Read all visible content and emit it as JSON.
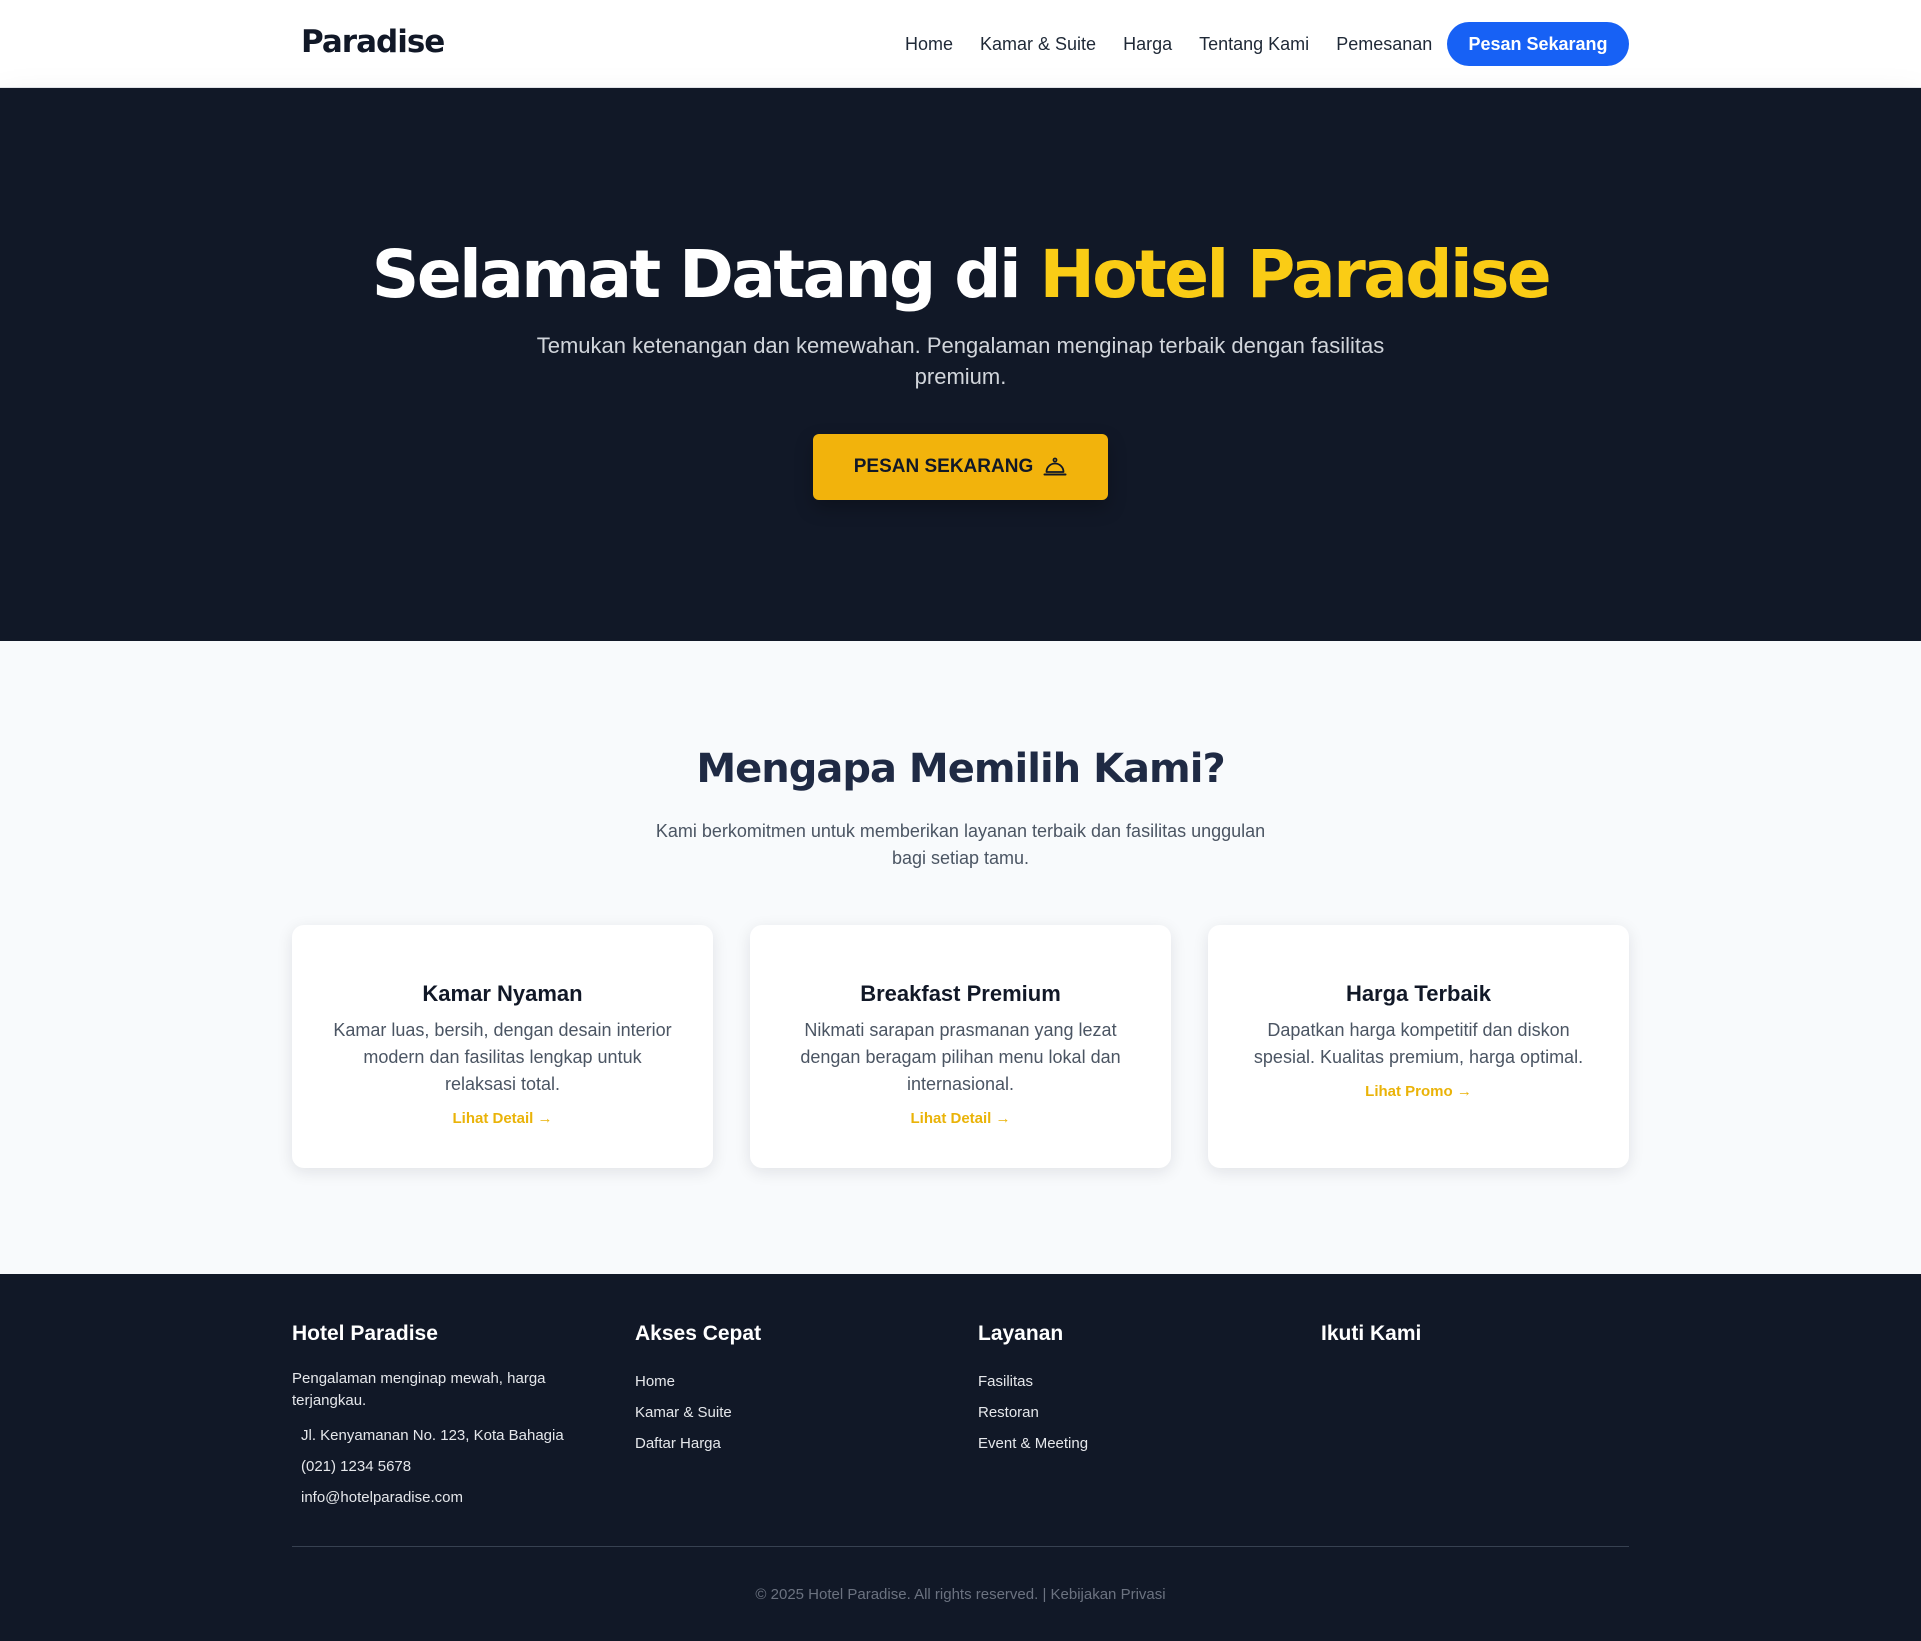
{
  "navbar": {
    "brand": "Paradise",
    "links": [
      "Home",
      "Kamar & Suite",
      "Harga",
      "Tentang Kami",
      "Pemesanan"
    ],
    "cta": "Pesan Sekarang"
  },
  "hero": {
    "title_main": "Selamat Datang di ",
    "title_accent": "Hotel Paradise",
    "subtitle": "Temukan ketenangan dan kemewahan. Pengalaman menginap terbaik dengan fasilitas premium.",
    "button": "PESAN SEKARANG",
    "button_icon": "bell-icon"
  },
  "features": {
    "title": "Mengapa Memilih Kami?",
    "subtitle": "Kami berkomitmen untuk memberikan layanan terbaik dan fasilitas unggulan bagi setiap tamu.",
    "cards": [
      {
        "title": "Kamar Nyaman",
        "text": "Kamar luas, bersih, dengan desain interior modern dan fasilitas lengkap untuk relaksasi total.",
        "link": "Lihat Detail →"
      },
      {
        "title": "Breakfast Premium",
        "text": "Nikmati sarapan prasmanan yang lezat dengan beragam pilihan menu lokal dan internasional.",
        "link": "Lihat Detail →"
      },
      {
        "title": "Harga Terbaik",
        "text": "Dapatkan harga kompetitif dan diskon spesial. Kualitas premium, harga optimal.",
        "link": "Lihat Promo →"
      }
    ]
  },
  "footer": {
    "about": {
      "title": "Hotel Paradise",
      "desc": "Pengalaman menginap mewah, harga terjangkau.",
      "address": "Jl. Kenyamanan No. 123, Kota Bahagia",
      "phone": "(021) 1234 5678",
      "email": "info@hotelparadise.com"
    },
    "quick": {
      "title": "Akses Cepat",
      "items": [
        "Home",
        "Kamar & Suite",
        "Daftar Harga"
      ]
    },
    "services": {
      "title": "Layanan",
      "items": [
        "Fasilitas",
        "Restoran",
        "Event & Meeting"
      ]
    },
    "follow": {
      "title": "Ikuti Kami"
    },
    "copyright": "© 2025 Hotel Paradise. All rights reserved. | Kebijakan Privasi"
  },
  "colors": {
    "accent_yellow": "#facc15",
    "button_yellow": "#f2b30c",
    "primary_blue": "#1761f5",
    "dark_bg": "#111827",
    "light_bg": "#f8fafc"
  }
}
